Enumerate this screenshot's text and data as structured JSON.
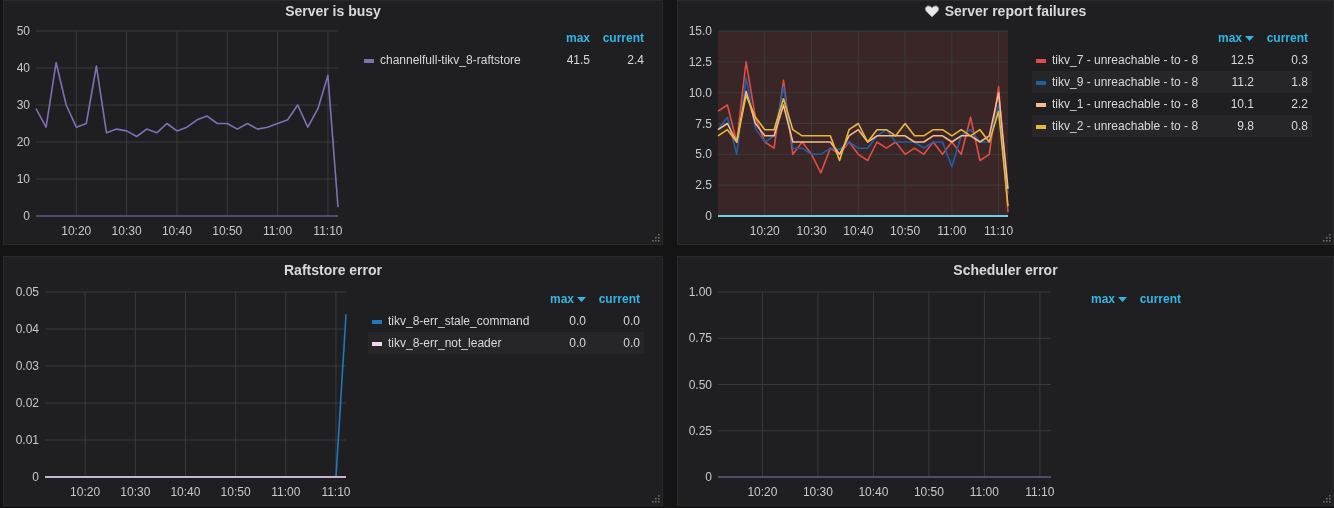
{
  "panels": [
    {
      "title": "Server is busy",
      "alert": false,
      "chart_data": {
        "type": "line",
        "categories": [
          null,
          null,
          null,
          null,
          "10:20",
          null,
          null,
          null,
          null,
          "10:30",
          null,
          null,
          null,
          null,
          "10:40",
          null,
          null,
          null,
          null,
          "10:50",
          null,
          null,
          null,
          null,
          "11:00",
          null,
          null,
          null,
          null,
          "11:10",
          null
        ],
        "grid": true,
        "ylim": [
          0,
          50
        ],
        "yticks": [
          {
            "value": 0,
            "label": "0"
          },
          {
            "value": 10,
            "label": "10"
          },
          {
            "value": 20,
            "label": "20"
          },
          {
            "value": 30,
            "label": "30"
          },
          {
            "value": 40,
            "label": "40"
          },
          {
            "value": 50,
            "label": "50"
          }
        ],
        "series": [
          {
            "name": "channelfull-tikv_8-raftstore",
            "color": "#806eb7",
            "values": [
              29,
              24,
              41.5,
              30,
              24,
              25,
              40.5,
              22.5,
              23.5,
              23,
              21.5,
              23.5,
              22.5,
              25,
              23,
              24,
              26,
              27,
              25,
              25,
              23.5,
              25,
              23.5,
              24,
              25,
              26,
              30,
              24,
              29,
              38,
              2.4
            ]
          }
        ]
      },
      "legend": {
        "columns": [
          {
            "label": "max",
            "sorted": false
          },
          {
            "label": "current",
            "sorted": false
          }
        ],
        "rows": [
          {
            "max": "41.5",
            "current": "2.4"
          }
        ]
      }
    },
    {
      "title": "Server report failures",
      "alert": true,
      "chart_data": {
        "type": "line",
        "categories": [
          null,
          null,
          null,
          null,
          null,
          "10:20",
          null,
          null,
          null,
          null,
          "10:30",
          null,
          null,
          null,
          null,
          "10:40",
          null,
          null,
          null,
          null,
          "10:50",
          null,
          null,
          null,
          null,
          "11:00",
          null,
          null,
          null,
          null,
          "11:10",
          null
        ],
        "grid": true,
        "ylim": [
          0,
          15
        ],
        "yticks": [
          {
            "value": 0,
            "label": "0"
          },
          {
            "value": 2.5,
            "label": "2.5"
          },
          {
            "value": 5,
            "label": "5.0"
          },
          {
            "value": 7.5,
            "label": "7.5"
          },
          {
            "value": 10,
            "label": "10.0"
          },
          {
            "value": 12.5,
            "label": "12.5"
          },
          {
            "value": 15,
            "label": "15.0"
          }
        ],
        "series": [
          {
            "name": "tikv_7 - unreachable - to - 8",
            "color": "#e24d42",
            "values": [
              8.5,
              9,
              6,
              12.5,
              8,
              6,
              5.5,
              11,
              5,
              6,
              5,
              3.5,
              5.5,
              5,
              6,
              5,
              4.5,
              6,
              5.5,
              6,
              5,
              5.5,
              5,
              6,
              5,
              6,
              5,
              8,
              4.5,
              5,
              10.5,
              0.3
            ]
          },
          {
            "name": "tikv_9 - unreachable - to - 8",
            "color": "#1f5ea8",
            "values": [
              7,
              8,
              5,
              11.2,
              7.1,
              6,
              6.5,
              10.5,
              5.5,
              5.5,
              5,
              5,
              5.5,
              5.4,
              6,
              5.5,
              5.5,
              6.5,
              7,
              6,
              6,
              6,
              5.5,
              6,
              6,
              4,
              6.5,
              7,
              6,
              6,
              9,
              1.8
            ]
          },
          {
            "name": "tikv_1 - unreachable - to - 8",
            "color": "#f9ba8f",
            "values": [
              7,
              7.5,
              6,
              10.1,
              7.5,
              6.5,
              6.5,
              9,
              6,
              6,
              6,
              6,
              6,
              5,
              6.5,
              7,
              6,
              6.5,
              6.5,
              6.5,
              6.5,
              6,
              6,
              6.5,
              6.5,
              6,
              6.5,
              6.5,
              6,
              6.5,
              10,
              2.2
            ]
          },
          {
            "name": "tikv_2 - unreachable - to - 8",
            "color": "#eab839",
            "values": [
              6.5,
              7,
              6,
              9.8,
              8,
              7,
              7,
              9.5,
              7,
              6.5,
              6.5,
              6.5,
              6.5,
              4.5,
              7,
              7.5,
              6,
              7,
              7,
              6.5,
              7.5,
              6.5,
              6.5,
              7,
              7,
              6.5,
              7,
              6.5,
              7,
              6,
              8.5,
              0.8
            ]
          }
        ]
      },
      "legend": {
        "columns": [
          {
            "label": "max",
            "sorted": true
          },
          {
            "label": "current",
            "sorted": false
          }
        ],
        "rows": [
          {
            "max": "12.5",
            "current": "0.3"
          },
          {
            "max": "11.2",
            "current": "1.8"
          },
          {
            "max": "10.1",
            "current": "2.2"
          },
          {
            "max": "9.8",
            "current": "0.8"
          }
        ]
      }
    },
    {
      "title": "Raftstore error",
      "alert": false,
      "chart_data": {
        "type": "line",
        "categories": [
          null,
          null,
          null,
          null,
          "10:20",
          null,
          null,
          null,
          null,
          "10:30",
          null,
          null,
          null,
          null,
          "10:40",
          null,
          null,
          null,
          null,
          "10:50",
          null,
          null,
          null,
          null,
          "11:00",
          null,
          null,
          null,
          null,
          "11:10",
          null
        ],
        "grid": true,
        "ylim": [
          0,
          0.05
        ],
        "yticks": [
          {
            "value": 0,
            "label": "0"
          },
          {
            "value": 0.01,
            "label": "0.01"
          },
          {
            "value": 0.02,
            "label": "0.02"
          },
          {
            "value": 0.03,
            "label": "0.03"
          },
          {
            "value": 0.04,
            "label": "0.04"
          },
          {
            "value": 0.05,
            "label": "0.05"
          }
        ],
        "series": [
          {
            "name": "tikv_8-err_stale_command",
            "color": "#1f78c1",
            "values": [
              null,
              null,
              null,
              null,
              null,
              null,
              null,
              null,
              null,
              null,
              null,
              null,
              null,
              null,
              null,
              null,
              null,
              null,
              null,
              null,
              null,
              null,
              null,
              null,
              null,
              null,
              null,
              null,
              null,
              0,
              0.044
            ]
          },
          {
            "name": "tikv_8-err_not_leader",
            "color": "#f4d5f3",
            "values": [
              0,
              0,
              0,
              0,
              0,
              0,
              0,
              0,
              0,
              0,
              0,
              0,
              0,
              0,
              0,
              0,
              0,
              0,
              0,
              0,
              0,
              0,
              0,
              0,
              0,
              0,
              0,
              0,
              0,
              0,
              0
            ]
          }
        ]
      },
      "legend": {
        "columns": [
          {
            "label": "max",
            "sorted": true
          },
          {
            "label": "current",
            "sorted": false
          }
        ],
        "rows": [
          {
            "max": "0.0",
            "current": "0.0"
          },
          {
            "max": "0.0",
            "current": "0.0"
          }
        ]
      }
    },
    {
      "title": "Scheduler error",
      "alert": false,
      "chart_data": {
        "type": "line",
        "categories": [
          null,
          null,
          null,
          null,
          "10:20",
          null,
          null,
          null,
          null,
          "10:30",
          null,
          null,
          null,
          null,
          "10:40",
          null,
          null,
          null,
          null,
          "10:50",
          null,
          null,
          null,
          null,
          "11:00",
          null,
          null,
          null,
          null,
          "11:10",
          null
        ],
        "grid": true,
        "ylim": [
          0,
          1
        ],
        "yticks": [
          {
            "value": 0,
            "label": "0"
          },
          {
            "value": 0.25,
            "label": "0.25"
          },
          {
            "value": 0.5,
            "label": "0.50"
          },
          {
            "value": 0.75,
            "label": "0.75"
          },
          {
            "value": 1,
            "label": "1.00"
          }
        ]
      },
      "legend": {
        "columns": [
          {
            "label": "max",
            "sorted": true
          },
          {
            "label": "current",
            "sorted": false
          }
        ]
      }
    }
  ]
}
